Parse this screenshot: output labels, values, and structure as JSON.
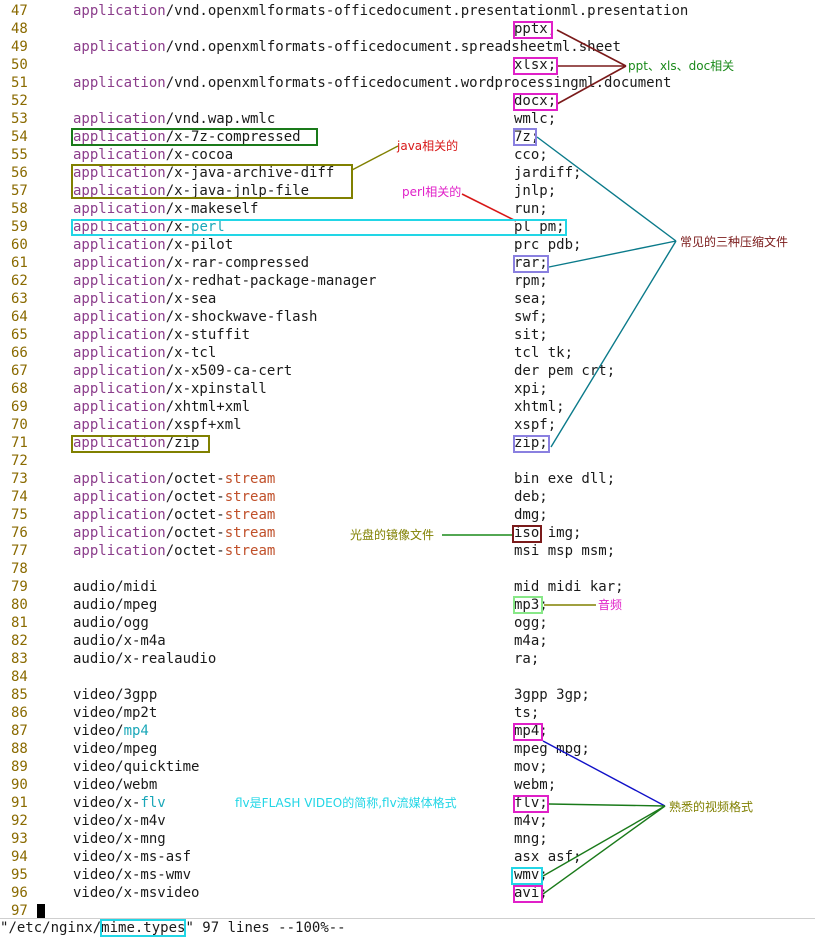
{
  "editor": {
    "lines": [
      {
        "n": "47",
        "type": "application",
        "sub": "/vnd.openxmlformats-officedocument.presentationml.presentation",
        "ext": ""
      },
      {
        "n": "48",
        "type": "",
        "sub": "",
        "ext": "pptx;"
      },
      {
        "n": "49",
        "type": "application",
        "sub": "/vnd.openxmlformats-officedocument.spreadsheetml.sheet",
        "ext": ""
      },
      {
        "n": "50",
        "type": "",
        "sub": "",
        "ext": "xlsx;"
      },
      {
        "n": "51",
        "type": "application",
        "sub": "/vnd.openxmlformats-officedocument.wordprocessingml.document",
        "ext": ""
      },
      {
        "n": "52",
        "type": "",
        "sub": "",
        "ext": "docx;"
      },
      {
        "n": "53",
        "type": "application",
        "sub": "/vnd.wap.wmlc",
        "ext": "wmlc;"
      },
      {
        "n": "54",
        "type": "application",
        "sub": "/x-7z-compressed",
        "ext": "7z;"
      },
      {
        "n": "55",
        "type": "application",
        "sub": "/x-cocoa",
        "ext": "cco;"
      },
      {
        "n": "56",
        "type": "application",
        "sub": "/x-java-archive-diff",
        "ext": "jardiff;"
      },
      {
        "n": "57",
        "type": "application",
        "sub": "/x-java-jnlp-file",
        "ext": "jnlp;"
      },
      {
        "n": "58",
        "type": "application",
        "sub": "/x-makeself",
        "ext": "run;"
      },
      {
        "n": "59",
        "type": "application",
        "sub": "/x-",
        "hl": "perl",
        "hlc": "hlt",
        "ext": "pl pm;"
      },
      {
        "n": "60",
        "type": "application",
        "sub": "/x-pilot",
        "ext": "prc pdb;"
      },
      {
        "n": "61",
        "type": "application",
        "sub": "/x-rar-compressed",
        "ext": "rar;"
      },
      {
        "n": "62",
        "type": "application",
        "sub": "/x-redhat-package-manager",
        "ext": "rpm;"
      },
      {
        "n": "63",
        "type": "application",
        "sub": "/x-sea",
        "ext": "sea;"
      },
      {
        "n": "64",
        "type": "application",
        "sub": "/x-shockwave-flash",
        "ext": "swf;"
      },
      {
        "n": "65",
        "type": "application",
        "sub": "/x-stuffit",
        "ext": "sit;"
      },
      {
        "n": "66",
        "type": "application",
        "sub": "/x-tcl",
        "ext": "tcl tk;"
      },
      {
        "n": "67",
        "type": "application",
        "sub": "/x-x509-ca-cert",
        "ext": "der pem crt;"
      },
      {
        "n": "68",
        "type": "application",
        "sub": "/x-xpinstall",
        "ext": "xpi;"
      },
      {
        "n": "69",
        "type": "application",
        "sub": "/xhtml+xml",
        "ext": "xhtml;"
      },
      {
        "n": "70",
        "type": "application",
        "sub": "/xspf+xml",
        "ext": "xspf;"
      },
      {
        "n": "71",
        "type": "application",
        "sub": "/zip",
        "ext": "zip;"
      },
      {
        "n": "72",
        "type": "",
        "sub": "",
        "ext": ""
      },
      {
        "n": "73",
        "type": "application",
        "sub": "/octet-",
        "hl": "stream",
        "hlc": "hlr",
        "ext": "bin exe dll;"
      },
      {
        "n": "74",
        "type": "application",
        "sub": "/octet-",
        "hl": "stream",
        "hlc": "hlr",
        "ext": "deb;"
      },
      {
        "n": "75",
        "type": "application",
        "sub": "/octet-",
        "hl": "stream",
        "hlc": "hlr",
        "ext": "dmg;"
      },
      {
        "n": "76",
        "type": "application",
        "sub": "/octet-",
        "hl": "stream",
        "hlc": "hlr",
        "ext": "iso img;"
      },
      {
        "n": "77",
        "type": "application",
        "sub": "/octet-",
        "hl": "stream",
        "hlc": "hlr",
        "ext": "msi msp msm;"
      },
      {
        "n": "78",
        "type": "",
        "sub": "",
        "ext": ""
      },
      {
        "n": "79",
        "type": "",
        "sub": "audio/midi",
        "ext": "mid midi kar;"
      },
      {
        "n": "80",
        "type": "",
        "sub": "audio/mpeg",
        "ext": "mp3;"
      },
      {
        "n": "81",
        "type": "",
        "sub": "audio/ogg",
        "ext": "ogg;"
      },
      {
        "n": "82",
        "type": "",
        "sub": "audio/x-m4a",
        "ext": "m4a;"
      },
      {
        "n": "83",
        "type": "",
        "sub": "audio/x-realaudio",
        "ext": "ra;"
      },
      {
        "n": "84",
        "type": "",
        "sub": "",
        "ext": ""
      },
      {
        "n": "85",
        "type": "",
        "sub": "video/3gpp",
        "ext": "3gpp 3gp;"
      },
      {
        "n": "86",
        "type": "",
        "sub": "video/mp2t",
        "ext": "ts;"
      },
      {
        "n": "87",
        "type": "",
        "sub": "video/",
        "hl": "mp4",
        "hlc": "hlt",
        "ext": "mp4;"
      },
      {
        "n": "88",
        "type": "",
        "sub": "video/mpeg",
        "ext": "mpeg mpg;"
      },
      {
        "n": "89",
        "type": "",
        "sub": "video/quicktime",
        "ext": "mov;"
      },
      {
        "n": "90",
        "type": "",
        "sub": "video/webm",
        "ext": "webm;"
      },
      {
        "n": "91",
        "type": "",
        "sub": "video/x-",
        "hl": "flv",
        "hlc": "hlt",
        "ext": "flv;"
      },
      {
        "n": "92",
        "type": "",
        "sub": "video/x-m4v",
        "ext": "m4v;"
      },
      {
        "n": "93",
        "type": "",
        "sub": "video/x-mng",
        "ext": "mng;"
      },
      {
        "n": "94",
        "type": "",
        "sub": "video/x-ms-asf",
        "ext": "asx asf;"
      },
      {
        "n": "95",
        "type": "",
        "sub": "video/x-ms-wmv",
        "ext": "wmv;"
      },
      {
        "n": "96",
        "type": "",
        "sub": "video/x-msvideo",
        "ext": "avi;"
      },
      {
        "n": "97",
        "type": "",
        "sub": "",
        "ext": ""
      }
    ]
  },
  "annotations": {
    "office": "ppt、xls、doc相关",
    "java": "java相关的",
    "perl": "perl相关的",
    "compress": "常见的三种压缩文件",
    "iso": "光盘的镜像文件",
    "audio": "音频",
    "flv": "flv是FLASH VIDEO的简称,flv流媒体格式",
    "video": "熟悉的视频格式"
  },
  "status": {
    "quote_open": "\"",
    "path_prefix": "/etc/nginx/",
    "filename": "mime.types",
    "rest": "\" 97 lines --100%--"
  },
  "colors": {
    "magenta": "#e020c8",
    "cyan": "#22d6e6",
    "olive": "#808000",
    "green": "#1a7a1a",
    "purple": "#8a80e0",
    "lightgreen": "#88e888",
    "darkred": "#7a1a1a",
    "teal": "#0a7a8a",
    "blue": "#1010c8",
    "red": "#d81818"
  }
}
